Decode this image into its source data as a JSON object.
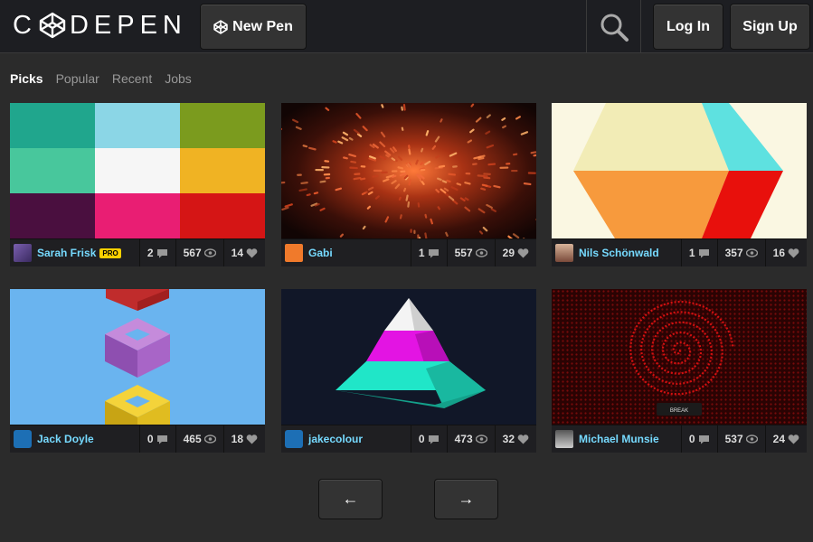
{
  "header": {
    "logo_text_a": "C",
    "logo_text_b": "DEPEN",
    "new_pen_label": "New Pen",
    "login_label": "Log In",
    "signup_label": "Sign Up"
  },
  "tabs": [
    {
      "label": "Picks",
      "active": true
    },
    {
      "label": "Popular",
      "active": false
    },
    {
      "label": "Recent",
      "active": false
    },
    {
      "label": "Jobs",
      "active": false
    }
  ],
  "cards": [
    {
      "author": "Sarah Frisk",
      "pro": "PRO",
      "comments": "2",
      "views": "567",
      "likes": "14"
    },
    {
      "author": "Gabi",
      "comments": "1",
      "views": "557",
      "likes": "29"
    },
    {
      "author": "Nils Schönwald",
      "comments": "1",
      "views": "357",
      "likes": "16"
    },
    {
      "author": "Jack Doyle",
      "comments": "0",
      "views": "465",
      "likes": "18"
    },
    {
      "author": "jakecolour",
      "comments": "0",
      "views": "473",
      "likes": "32"
    },
    {
      "author": "Michael Munsie",
      "comments": "0",
      "views": "537",
      "likes": "24"
    }
  ],
  "spiral_caption": "BREAK",
  "pager": {
    "prev": "←",
    "next": "→"
  },
  "colors": {
    "accent_link": "#76daff",
    "pro_badge": "#fcd000",
    "background": "#2b2b2b"
  }
}
